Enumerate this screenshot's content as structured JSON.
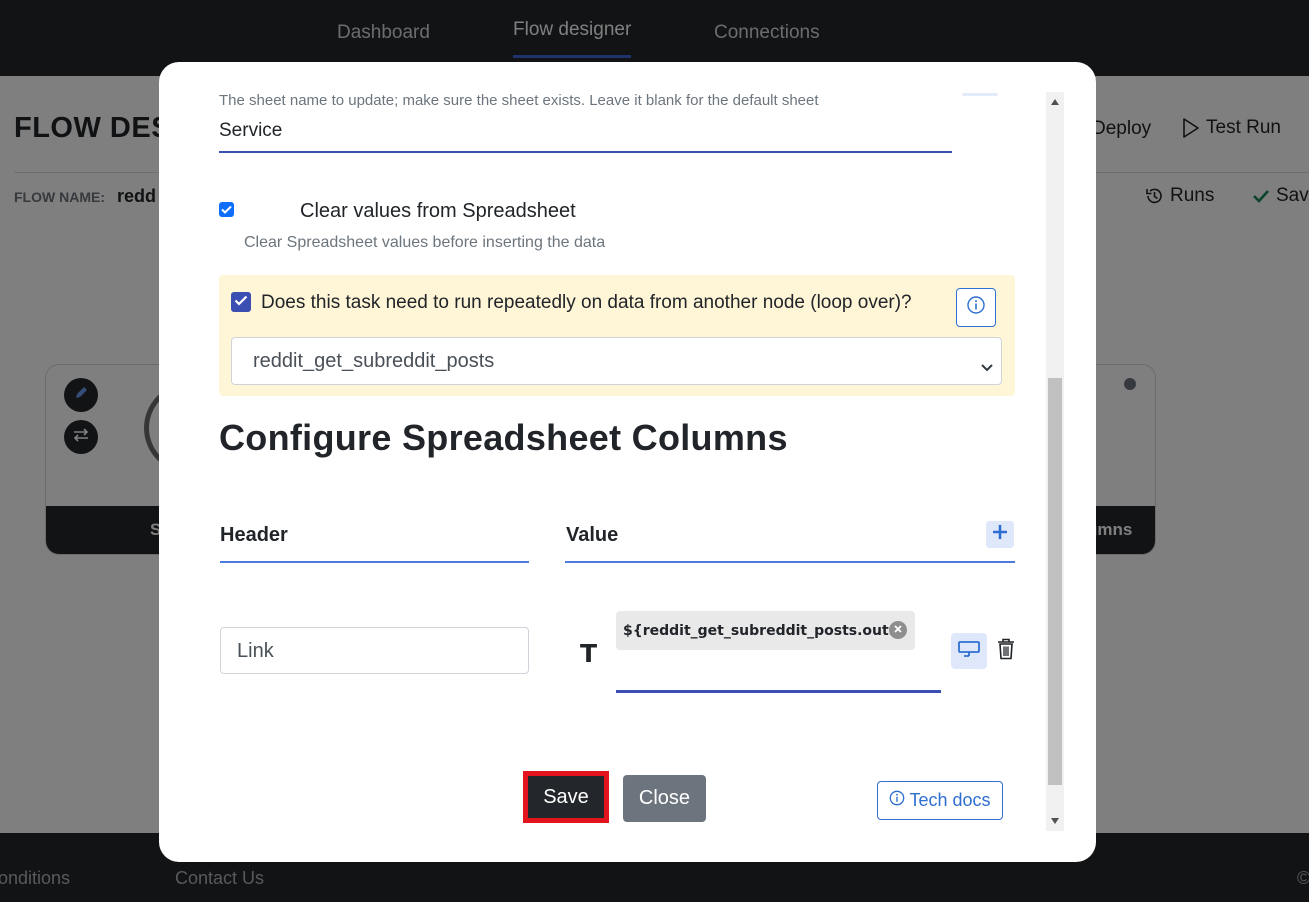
{
  "nav": {
    "tabs": [
      "Dashboard",
      "Flow designer",
      "Connections"
    ],
    "active_tab": "Flow designer"
  },
  "page": {
    "title": "FLOW DES",
    "flow_name_label": "FLOW NAME:",
    "flow_name_value": "redd",
    "actions": {
      "deploy": "Deploy",
      "test_run": "Test Run",
      "runs": "Runs",
      "save": "Save"
    },
    "node_left_label": "S",
    "node_right_label": "umns"
  },
  "footer": {
    "links": [
      "onditions",
      "Contact Us"
    ],
    "copyright": "©"
  },
  "modal": {
    "sheet_hint": "The sheet name to update; make sure the sheet exists. Leave it blank for the default sheet",
    "sheet_value": "Service",
    "clear_values": {
      "checked": true,
      "label": "Clear values from Spreadsheet",
      "description": "Clear Spreadsheet values before inserting the data"
    },
    "loop": {
      "checked": true,
      "label": "Does this task need to run repeatedly on data from another node (loop over)?",
      "selected": "reddit_get_subreddit_posts"
    },
    "section_title": "Configure Spreadsheet Columns",
    "columns": {
      "header_label": "Header",
      "value_label": "Value",
      "rows": [
        {
          "header": "Link",
          "value_chip": "${reddit_get_subreddit_posts.out..."
        }
      ]
    },
    "buttons": {
      "save": "Save",
      "close": "Close",
      "docs": "Tech docs"
    }
  },
  "colors": {
    "accent": "#3a4fb1",
    "link_blue": "#2f6fd1",
    "loop_bg": "#fff6d8",
    "dark": "#23272b",
    "highlight": "#e3141e"
  }
}
